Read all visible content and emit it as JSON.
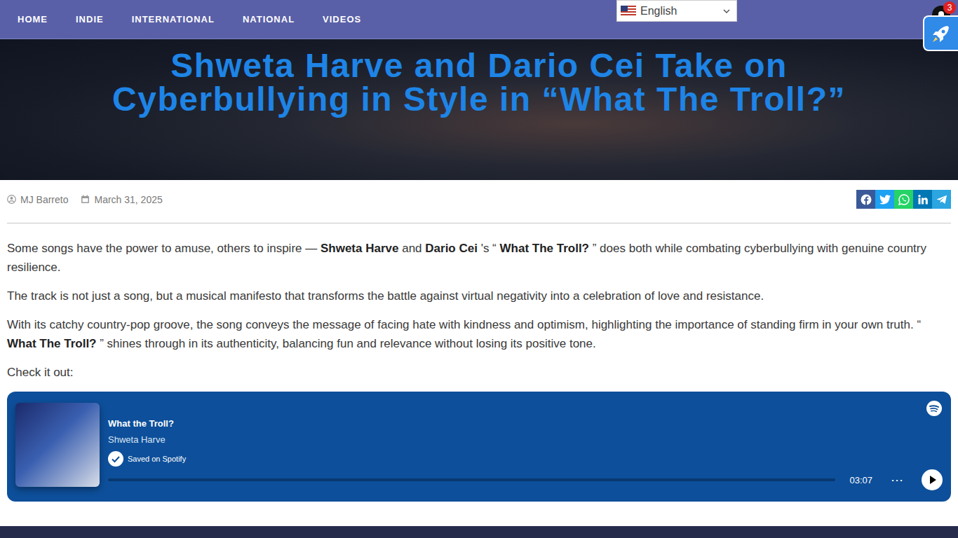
{
  "nav": {
    "items": [
      "HOME",
      "INDIE",
      "INTERNATIONAL",
      "NATIONAL",
      "VIDEOS"
    ]
  },
  "translate": {
    "language": "English"
  },
  "notifications": {
    "count": "3"
  },
  "article": {
    "title_lines": [
      "Shweta Harve and Dario Cei Take on",
      "Cyberbullying in Style in “What The Troll?”"
    ],
    "author": "MJ Barreto",
    "date": "March 31, 2025",
    "share": [
      {
        "kind": "facebook",
        "color": "#3b5998"
      },
      {
        "kind": "twitter",
        "color": "#1da1f2"
      },
      {
        "kind": "whatsapp",
        "color": "#25d366"
      },
      {
        "kind": "linkedin",
        "color": "#0077b5"
      },
      {
        "kind": "telegram",
        "color": "#2ca5e0"
      }
    ],
    "paragraphs": [
      [
        {
          "text": "Some songs have the power to amuse, others to inspire — ",
          "bold": false
        },
        {
          "text": "Shweta Harve",
          "bold": true
        },
        {
          "text": " and ",
          "bold": false
        },
        {
          "text": "Dario Cei",
          "bold": true
        },
        {
          "text": " 's “ ",
          "bold": false
        },
        {
          "text": "What The Troll?",
          "bold": true
        },
        {
          "text": " ” does both while combating cyberbullying with genuine country resilience.",
          "bold": false
        }
      ],
      [
        {
          "text": "The track is not just a song, but a musical manifesto that transforms the battle against virtual negativity into a celebration of love and resistance.",
          "bold": false
        }
      ],
      [
        {
          "text": "With its catchy country-pop groove, the song conveys the message of facing hate with kindness and optimism, highlighting the importance of standing firm in your own truth. “ ",
          "bold": false
        },
        {
          "text": "What The Troll?",
          "bold": true
        },
        {
          "text": " ” shines through in its authenticity, balancing fun and relevance without losing its positive tone.",
          "bold": false
        }
      ],
      [
        {
          "text": "Check it out:",
          "bold": false
        }
      ]
    ]
  },
  "embed": {
    "title": "What the Troll?",
    "artist": "Shweta Harve",
    "saved": "Saved on Spotify",
    "duration": "03:07",
    "more": "⋯",
    "level": 0
  }
}
